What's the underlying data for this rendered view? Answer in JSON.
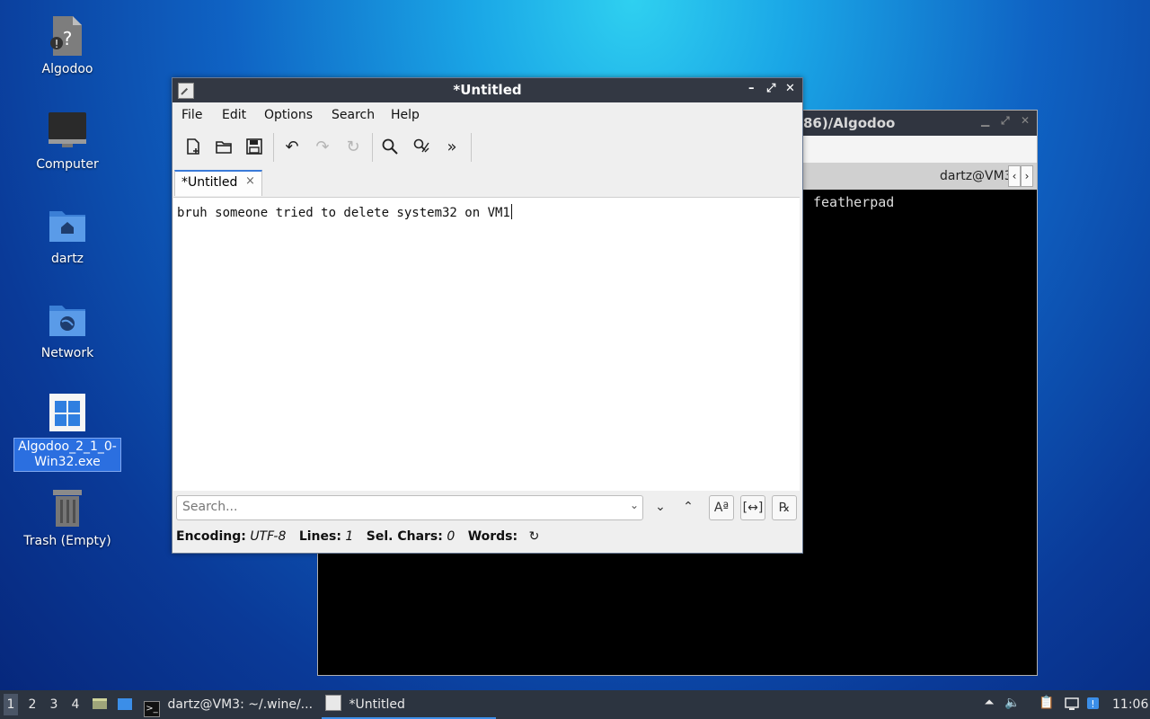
{
  "desktop_icons": [
    {
      "label": "Algodoo",
      "icon": "unknown-file-icon"
    },
    {
      "label": "Computer",
      "icon": "monitor-icon"
    },
    {
      "label": "dartz",
      "icon": "home-folder-icon"
    },
    {
      "label": "Network",
      "icon": "network-folder-icon"
    },
    {
      "label": "Algodoo_2_1_0-Win32.exe",
      "icon": "windows-exe-icon"
    },
    {
      "label": "Trash (Empty)",
      "icon": "trash-icon"
    }
  ],
  "terminal": {
    "title_fragment": "86)/Algodoo",
    "tab_label": "dartz@VM3",
    "output_line": "featherpad"
  },
  "editor": {
    "title": "*Untitled",
    "menu": [
      "File",
      "Edit",
      "Options",
      "Search",
      "Help"
    ],
    "tab_label": "*Untitled",
    "tab_close": "×",
    "content": "bruh someone tried to delete system32 on VM1",
    "search_placeholder": "Search...",
    "status": {
      "encoding_label": "Encoding:",
      "encoding_value": "UTF-8",
      "lines_label": "Lines:",
      "lines_value": "1",
      "sel_label": "Sel. Chars:",
      "sel_value": "0",
      "words_label": "Words:"
    }
  },
  "taskbar": {
    "workspaces": [
      "1",
      "2",
      "3",
      "4"
    ],
    "tasks": [
      {
        "label": "dartz@VM3: ~/.wine/...",
        "icon": "terminal-icon"
      },
      {
        "label": "*Untitled",
        "icon": "featherpad-icon"
      }
    ],
    "clock": "11:06"
  },
  "colors": {
    "titlebar": "#333843",
    "accent": "#3a7ad8",
    "taskbar": "#2c3440"
  }
}
